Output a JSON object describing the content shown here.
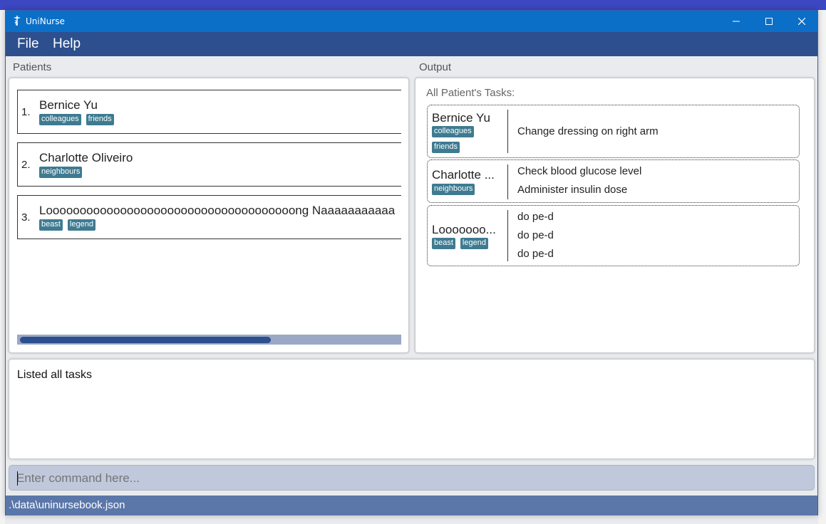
{
  "window": {
    "title": "UniNurse"
  },
  "menu": [
    {
      "label": "File"
    },
    {
      "label": "Help"
    }
  ],
  "sections": {
    "patients": "Patients",
    "output": "Output"
  },
  "patients": [
    {
      "index": "1.",
      "name": "Bernice Yu",
      "tags": [
        "colleagues",
        "friends"
      ]
    },
    {
      "index": "2.",
      "name": "Charlotte Oliveiro",
      "tags": [
        "neighbours"
      ]
    },
    {
      "index": "3.",
      "name": "Looooooooooooooooooooooooooooooooooooong Naaaaaaaaaaa",
      "tags": [
        "beast",
        "legend"
      ]
    }
  ],
  "output": {
    "heading": "All Patient's Tasks:",
    "cards": [
      {
        "name": "Bernice Yu",
        "tags": [
          "colleagues",
          "friends"
        ],
        "tasks": [
          "Change dressing on right arm"
        ]
      },
      {
        "name": "Charlotte ...",
        "tags": [
          "neighbours"
        ],
        "tasks": [
          "Check blood glucose level",
          "Administer insulin dose"
        ]
      },
      {
        "name": "Looooooo...",
        "tags": [
          "beast",
          "legend"
        ],
        "tasks": [
          "do pe-d",
          "do pe-d",
          "do pe-d"
        ]
      }
    ]
  },
  "result": {
    "text": "Listed all tasks"
  },
  "command": {
    "placeholder": "Enter command here..."
  },
  "status": {
    "path": ".\\data\\uninursebook.json"
  },
  "colors": {
    "titlebar": "#0b6fc8",
    "menubar": "#2d4f8e",
    "tag": "#3e7b91",
    "statusbar": "#5b77a9",
    "command": "#c0c9dc"
  }
}
